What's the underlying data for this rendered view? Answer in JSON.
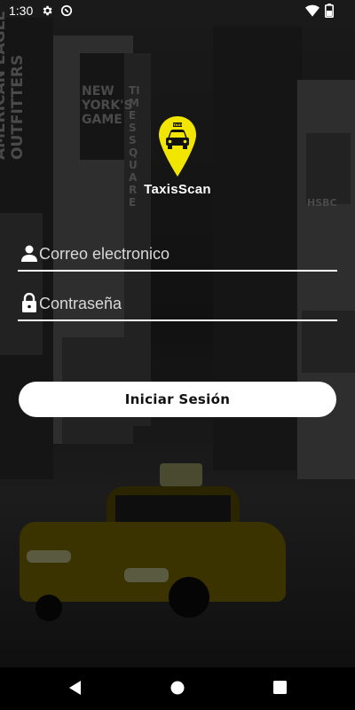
{
  "status_bar": {
    "time": "1:30"
  },
  "app": {
    "brand_name": "TaxisScan",
    "taxi_sign": "TAXI"
  },
  "background_signs": [
    "AMERICAN EAGLE OUTFITTERS",
    "NEW YORK'S GAME",
    "TIMES SQUARE",
    "HSBC"
  ],
  "login": {
    "email_placeholder": "Correo electronico",
    "password_placeholder": "Contraseña",
    "submit_label": "Iniciar Sesión"
  },
  "colors": {
    "accent": "#f2e600",
    "text": "#ffffff",
    "button_bg": "#ffffff",
    "button_text": "#111111"
  },
  "icons": [
    "gear-icon",
    "sync-icon",
    "wifi-icon",
    "battery-icon",
    "location-pin-icon",
    "person-icon",
    "lock-icon",
    "back-icon",
    "home-icon",
    "recents-icon"
  ]
}
